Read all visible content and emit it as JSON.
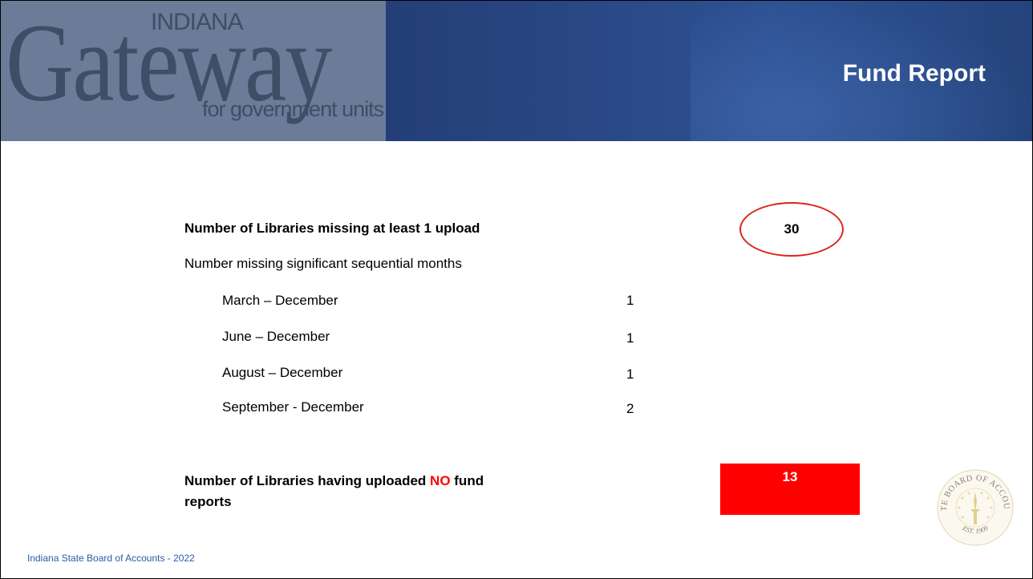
{
  "header": {
    "logo_state": "INDIANA",
    "logo_main": "Gateway",
    "logo_sub": "for government units",
    "title": "Fund Report"
  },
  "summary": {
    "missing_label": "Number of Libraries missing at least 1 upload",
    "missing_value": "30",
    "sequential_label": "Number missing significant sequential months",
    "sequential_rows": [
      {
        "period": "March – December",
        "count": "1"
      },
      {
        "period": "June – December",
        "count": "1"
      },
      {
        "period": "August – December",
        "count": "1"
      },
      {
        "period": "September - December",
        "count": "2"
      }
    ],
    "none_label_before": "Number of Libraries having uploaded ",
    "none_label_emphasis": "NO",
    "none_label_after": " fund",
    "none_label_line2": "reports",
    "none_value": "13"
  },
  "footer": {
    "text": "Indiana State Board of Accounts - 2022"
  },
  "seal": {
    "icon": "state-board-of-accounts-seal-icon",
    "text_arc": "STATE BOARD OF ACCOUNTS",
    "established": "EST. 1909"
  },
  "colors": {
    "highlight_red": "#ff0000",
    "ellipse_red": "#d9261c",
    "banner_blue": "#243f78",
    "footer_blue": "#2b5aa8"
  }
}
